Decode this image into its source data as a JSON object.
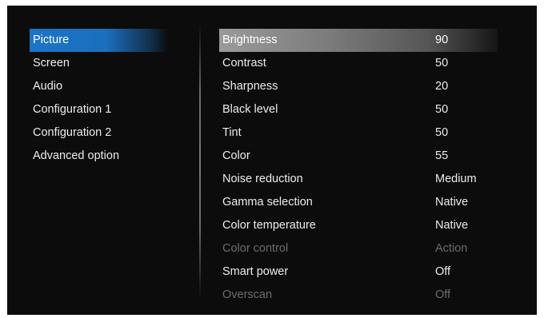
{
  "left_menu": {
    "items": [
      {
        "label": "Picture",
        "selected": true
      },
      {
        "label": "Screen",
        "selected": false
      },
      {
        "label": "Audio",
        "selected": false
      },
      {
        "label": "Configuration 1",
        "selected": false
      },
      {
        "label": "Configuration 2",
        "selected": false
      },
      {
        "label": "Advanced option",
        "selected": false
      }
    ]
  },
  "settings": {
    "rows": [
      {
        "label": "Brightness",
        "value": "90",
        "selected": true,
        "enabled": true
      },
      {
        "label": "Contrast",
        "value": "50",
        "selected": false,
        "enabled": true
      },
      {
        "label": "Sharpness",
        "value": "20",
        "selected": false,
        "enabled": true
      },
      {
        "label": "Black level",
        "value": "50",
        "selected": false,
        "enabled": true
      },
      {
        "label": "Tint",
        "value": "50",
        "selected": false,
        "enabled": true
      },
      {
        "label": "Color",
        "value": "55",
        "selected": false,
        "enabled": true
      },
      {
        "label": "Noise reduction",
        "value": "Medium",
        "selected": false,
        "enabled": true
      },
      {
        "label": "Gamma selection",
        "value": "Native",
        "selected": false,
        "enabled": true
      },
      {
        "label": "Color temperature",
        "value": "Native",
        "selected": false,
        "enabled": true
      },
      {
        "label": "Color control",
        "value": "Action",
        "selected": false,
        "enabled": false
      },
      {
        "label": "Smart power",
        "value": "Off",
        "selected": false,
        "enabled": true
      },
      {
        "label": "Overscan",
        "value": "Off",
        "selected": false,
        "enabled": false
      }
    ]
  },
  "colors": {
    "background": "#0c0c0c",
    "selection_blue": "#1b74c6",
    "selection_gray": "#8a8a8a",
    "text": "#ececec",
    "disabled_text": "#6c6c6c"
  }
}
